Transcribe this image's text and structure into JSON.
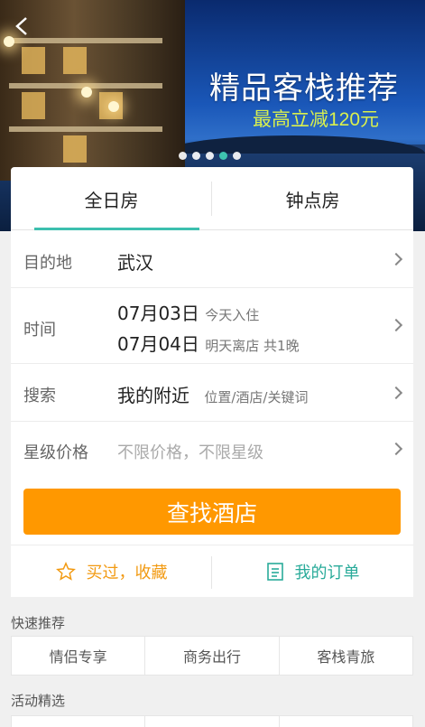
{
  "banner": {
    "title": "精品客栈推荐",
    "subtitle": "最高立减120元",
    "slide_count": 5,
    "active_slide": 4
  },
  "tabs": [
    {
      "label": "全日房",
      "active": true
    },
    {
      "label": "钟点房",
      "active": false
    }
  ],
  "form": {
    "destination": {
      "label": "目的地",
      "value": "武汉"
    },
    "time": {
      "label": "时间",
      "checkin_date": "07月03日",
      "checkin_hint": "今天入住",
      "checkout_date": "07月04日",
      "checkout_hint": "明天离店 共1晚"
    },
    "search": {
      "label": "搜索",
      "value": "我的附近",
      "hint": "位置/酒店/关键词"
    },
    "star_price": {
      "label": "星级价格",
      "placeholder": "不限价格，不限星级"
    },
    "submit_label": "查找酒店"
  },
  "links": {
    "favorites_label": "买过，收藏",
    "orders_label": "我的订单"
  },
  "quick_recommend": {
    "title": "快速推荐",
    "items": [
      "情侣专享",
      "商务出行",
      "客栈青旅"
    ]
  },
  "activities": {
    "title": "活动精选"
  },
  "colors": {
    "accent": "#3cbfae",
    "button": "#ff9800",
    "favorites": "#f29a12",
    "orders": "#2aab9a"
  }
}
